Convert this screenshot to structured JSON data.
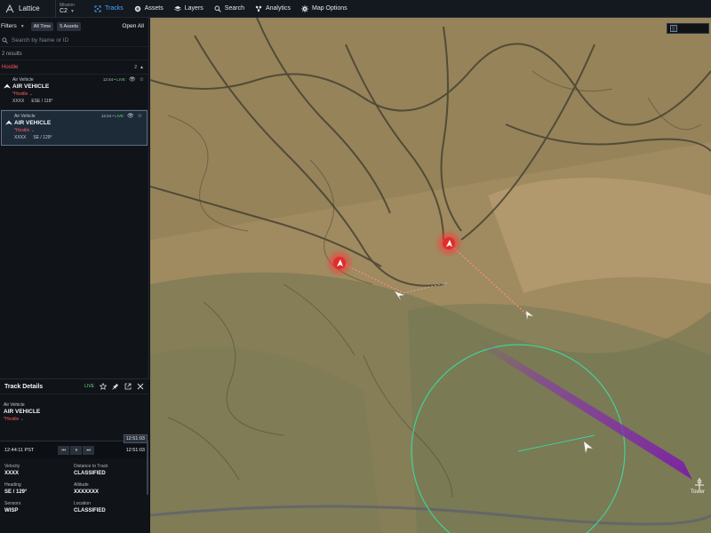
{
  "app": {
    "name": "Lattice"
  },
  "mission": {
    "label": "Mission",
    "value": "C2"
  },
  "nav": [
    {
      "label": "Tracks",
      "icon": "tracks-icon",
      "active": true
    },
    {
      "label": "Assets",
      "icon": "assets-icon"
    },
    {
      "label": "Layers",
      "icon": "layers-icon"
    },
    {
      "label": "Search",
      "icon": "search-icon"
    },
    {
      "label": "Analytics",
      "icon": "analytics-icon"
    },
    {
      "label": "Map Options",
      "icon": "gear-icon"
    }
  ],
  "filters": {
    "label": "Filters",
    "time": "All Time",
    "assets": "5 Assets",
    "open_all": "Open All"
  },
  "search": {
    "placeholder": "Search by Name or ID"
  },
  "results": "2 results",
  "group": {
    "title": "Hostile",
    "count": "2"
  },
  "tracks": [
    {
      "kind": "Air Vehicle",
      "name": "AIR VEHICLE",
      "affiliation": "*Hostile",
      "id": "XXXX",
      "heading": "ESE / 118°",
      "time": "12:44",
      "status": "LIVE"
    },
    {
      "kind": "Air Vehicle",
      "name": "AIR VEHICLE",
      "affiliation": "*Hostile",
      "id": "XXXX",
      "heading": "SE / 129°",
      "time": "12:44",
      "status": "LIVE"
    }
  ],
  "details": {
    "title": "Track Details",
    "live": "LIVE",
    "kind": "Air Vehicle",
    "name": "AIR VEHICLE",
    "affiliation": "*Hostile",
    "time_badge": "12:51:03",
    "timeline_start": "12:44:11 PST",
    "timeline_end": "12:51:03",
    "props": [
      {
        "label": "Velocity",
        "value": "XXXX"
      },
      {
        "label": "Distance to Track",
        "value": "CLASSIFIED"
      },
      {
        "label": "Heading",
        "value": "SE / 129°"
      },
      {
        "label": "Altitude",
        "value": "XXXXXXX"
      },
      {
        "label": "Sensors",
        "value": "WISP"
      },
      {
        "label": "Location",
        "value": "CLASSIFIED"
      }
    ]
  },
  "map": {
    "tower_label": "Tower"
  },
  "colors": {
    "accent": "#49a7ff",
    "hostile": "#ff5a5a",
    "live": "#6fd27a",
    "range_ring": "#3fd39a",
    "sensor_beam": "#8a2fb5"
  }
}
